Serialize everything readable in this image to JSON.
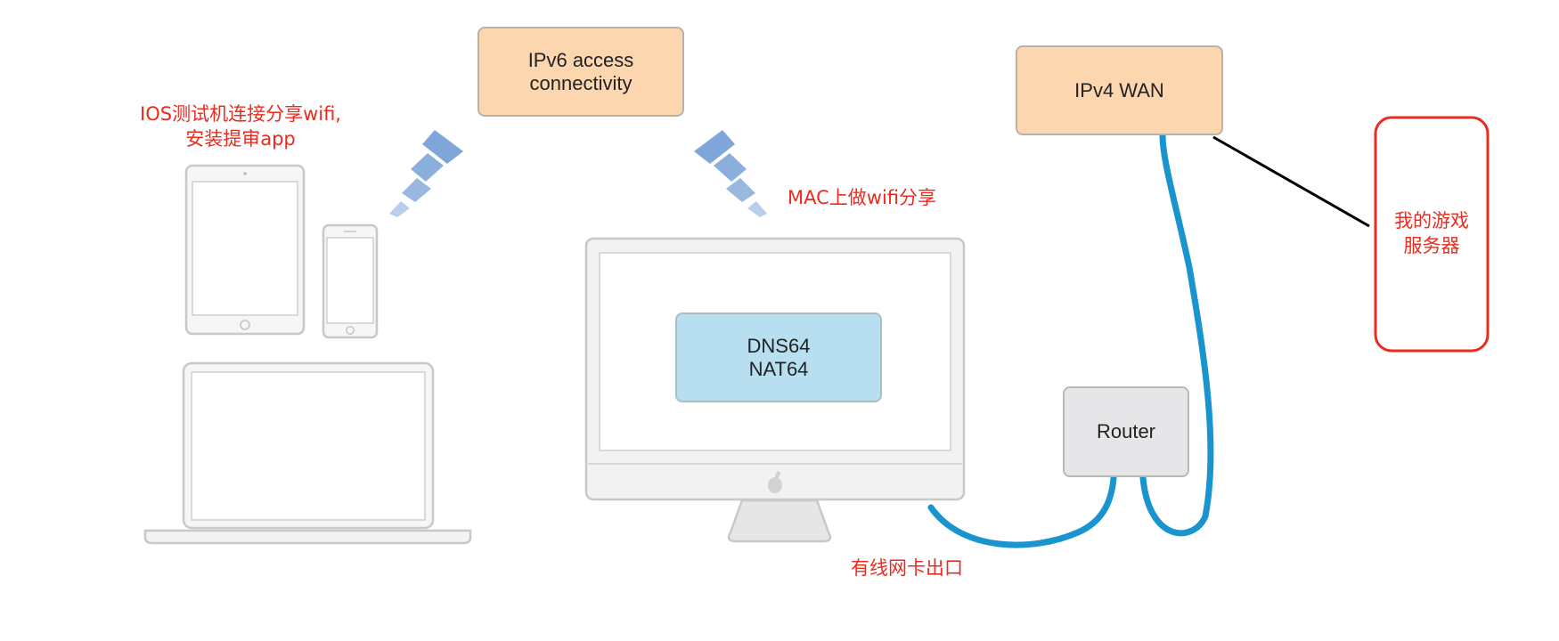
{
  "colors": {
    "accent_red": "#ea2c1f",
    "peach_box": "#fcd6af",
    "blue_box": "#b8dff0",
    "cable": "#1a94cf",
    "wifi": "#7ea6d8",
    "device_stroke": "#c8c8c8"
  },
  "boxes": {
    "ipv6": "IPv6 access connectivity",
    "ipv4": "IPv4 WAN",
    "dns64": "DNS64",
    "nat64": "NAT64",
    "router": "Router"
  },
  "labels": {
    "ios_line1": "IOS测试机连接分享wifi,",
    "ios_line2": "安装提审app",
    "mac_share": "MAC上做wifi分享",
    "wired_out": "有线网卡出口",
    "server_line1": "我的游戏",
    "server_line2": "服务器"
  },
  "icons": {
    "tablet": "tablet-icon",
    "phone": "phone-icon",
    "laptop": "laptop-icon",
    "desktop": "desktop-computer-icon",
    "wifi_left": "wifi-signal-icon",
    "wifi_right": "wifi-signal-icon",
    "apple_logo": "apple-logo-icon"
  }
}
